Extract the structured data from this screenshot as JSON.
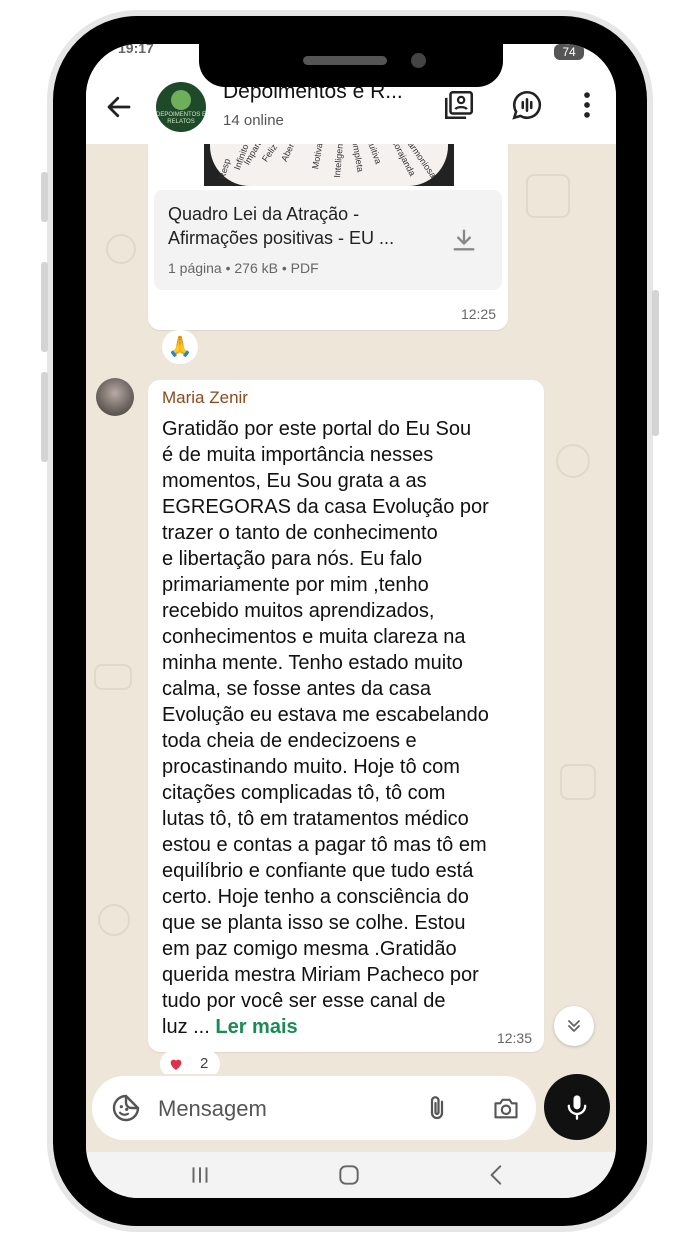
{
  "status": {
    "time": "19:17",
    "battery": "74"
  },
  "header": {
    "back_icon": "arrow-left-icon",
    "avatar_text": "DEPOIMENTOS E RELATOS",
    "title": "Depoimentos e R...",
    "subtitle": "14 online",
    "actions": [
      "media-gallery-icon",
      "voice-chat-icon",
      "more-vertical-icon"
    ]
  },
  "document": {
    "thumb_words": [
      "Infinito",
      "Imparável",
      "Feliz",
      "Aberta",
      "Motivada",
      "Inteligente",
      "Completa",
      "Intuitiva",
      "Encorajanda",
      "Harmoniosa",
      "Resp"
    ],
    "name": "Quadro Lei da Atração - Afirmações positivas - EU ...",
    "meta": "1 página • 276 kB • PDF",
    "time": "12:25",
    "reaction": "🙏"
  },
  "message": {
    "sender": "Maria Zenir",
    "lines": [
      "Gratidão  por este portal  do Eu Sou",
      "é  de muita importância  nesses",
      "momentos,  Eu Sou grata a as",
      "EGREGORAS da casa Evolução  por",
      "trazer o tanto  de conhecimento",
      "e libertação  para nós.  Eu falo",
      "primariamente  por mim ,tenho",
      "recebido muitos aprendizados,",
      "conhecimentos e muita clareza  na",
      "minha mente. Tenho estado muito",
      "calma, se fosse antes da casa",
      "Evolução  eu estava me escabelando",
      "toda cheia de endecizoens e",
      "procastinando  muito. Hoje tô com",
      "citações  complicadas tô, tô com",
      "lutas tô,  tô em tratamentos  médico",
      "estou e contas a pagar tô  mas tô em",
      "equilíbrio  e confiante que tudo está",
      "certo. Hoje  tenho a consciência  do",
      "que se planta isso se colhe. Estou",
      "em paz comigo mesma .Gratidão",
      "querida mestra Miriam Pacheco  por",
      "tudo por você  ser esse canal de"
    ],
    "last_line": "luz ... ",
    "read_more": "Ler mais",
    "time": "12:35",
    "reaction_emoji": "heart",
    "reaction_count": "2"
  },
  "input": {
    "placeholder": "Mensagem"
  },
  "colors": {
    "sender": "#8a4a1c",
    "read_more": "#1b8a53",
    "chat_bg": "#ede6d9"
  }
}
